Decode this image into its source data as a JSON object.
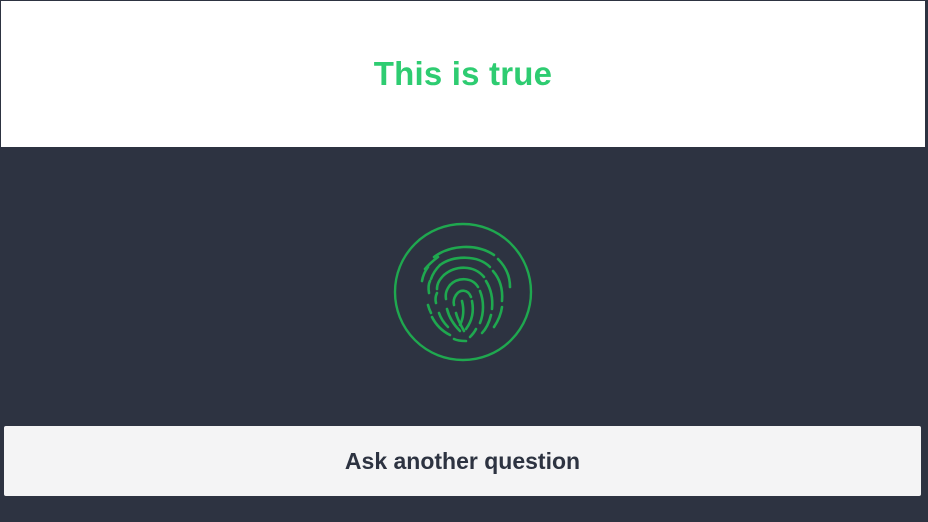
{
  "result": {
    "text": "This is true",
    "color": "#2ecc71"
  },
  "scanner": {
    "icon": "fingerprint-icon",
    "color": "#1fa84f"
  },
  "actions": {
    "ask_another_label": "Ask another question"
  },
  "theme": {
    "background": "#2d3341",
    "panel": "#ffffff",
    "button": "#f4f4f5"
  }
}
